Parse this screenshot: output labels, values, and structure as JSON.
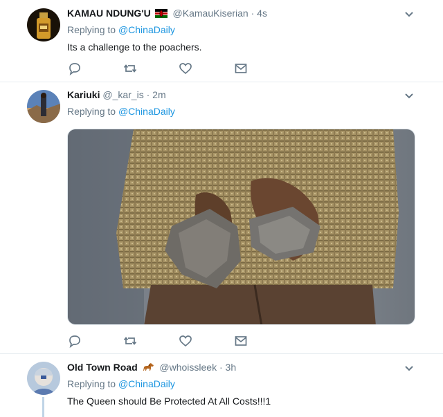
{
  "tweets": [
    {
      "name": "KAMAU NDUNG'U",
      "handle": "@KamauKiserian",
      "time": "4s",
      "replying_to": "Replying to",
      "mention": "@ChinaDaily",
      "text": "Its a challenge to the poachers."
    },
    {
      "name": "Kariuki",
      "handle": "@_kar_is",
      "time": "2m",
      "replying_to": "Replying to",
      "mention": "@ChinaDaily",
      "text": ""
    },
    {
      "name": "Old Town Road",
      "handle": "@whoissleek",
      "time": "3h",
      "replying_to": "Replying to",
      "mention": "@ChinaDaily",
      "text": "The Queen should Be Protected At All Costs!!!1"
    }
  ],
  "separator": "·",
  "icons": {
    "reply": "reply-icon",
    "retweet": "retweet-icon",
    "like": "heart-icon",
    "dm": "envelope-icon",
    "caret": "chevron-down-icon",
    "kenya_flag": "kenya-flag-icon",
    "horse": "horse-emoji-icon"
  },
  "colors": {
    "link": "#1b95e0",
    "secondary_text": "#657786",
    "divider": "#e6ecf0",
    "icon": "#657786"
  }
}
